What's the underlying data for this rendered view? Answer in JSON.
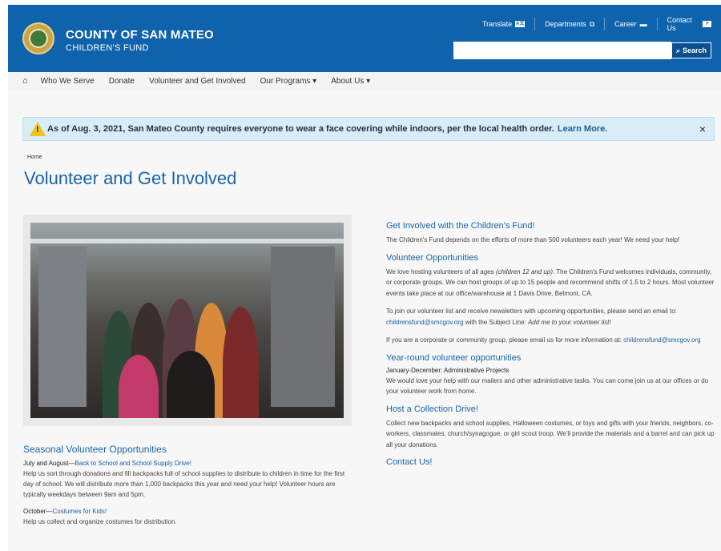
{
  "header": {
    "title": "COUNTY OF SAN MATEO",
    "subtitle": "CHILDREN'S FUND",
    "links": [
      "Translate",
      "Departments",
      "Career",
      "Contact Us"
    ],
    "search_placeholder": "",
    "search_button": "Search",
    "brand_color": "#0f62ac"
  },
  "nav": {
    "items": [
      "Who We Serve",
      "Donate",
      "Volunteer and Get Involved",
      "Our Programs ▾",
      "About Us ▾"
    ]
  },
  "alert": {
    "text": "As of Aug. 3, 2021, San Mateo County requires everyone to wear a face covering while indoors, per the local health order.",
    "link": "Learn More.",
    "close": "×"
  },
  "breadcrumb": "Home",
  "page_title": "Volunteer and Get Involved",
  "left": {
    "heading": "Seasonal Volunteer Opportunities",
    "items": [
      {
        "when": "July and August—",
        "link": "Back to School and School Supply Drive!",
        "text": "Help us sort through donations and fill backpacks full of school supplies to distribute to children in time for the first day of school. We will distribute more than 1,000 backpacks this year and need your help! Volunteer hours are typically weekdays between 9am and 5pm."
      },
      {
        "when": "October—",
        "link": "Costumes for Kids!",
        "text": "Help us collect and organize costumes for distribution."
      }
    ]
  },
  "right": {
    "get_involved_h": "Get Involved with the Children's Fund!",
    "get_involved_p": "The Children's Fund depends on the efforts of more than 500 volunteers each year! We need your help!",
    "vol_opps_h": "Volunteer Opportunities",
    "vol_opps_p1a": "We love hosting volunteers of all ages ",
    "vol_opps_p1b": "(children 12 and up)",
    "vol_opps_p1c": ". The Children's Fund welcomes individuals, community, or corporate groups. We can host groups of up to 15 people and recommend shifts of 1.5 to 2 hours. Most volunteer events take place at our office/warehouse at 1 Davis Drive, Belmont, CA.",
    "vol_opps_p2a": "To join our volunteer list and receive newsletters with upcoming opportunities, please send an email to: ",
    "vol_opps_p2link": "childrensfund@smcgov.org",
    "vol_opps_p2b": "  with the Subject Line: ",
    "vol_opps_p2c": "Add me to your volunteer list!",
    "vol_opps_p3a": "If you are a corporate or community group, please email us for more information at: ",
    "vol_opps_p3link": "childrensfund@smcgov.org",
    "yr_h": "Year-round volunteer opportunities",
    "yr_sub": "January-December:  Administrative Projects",
    "yr_p": "We would love your help with our mailers and other administrative tasks. You can come join us at our offices or do your volunteer work from home.",
    "collect_h": "Host a Collection Drive!",
    "collect_p": "Collect new backpacks and school supplies, Halloween costumes, or toys and gifts with your friends, neighbors, co-workers, classmates, church/synagogue, or girl scout troop. We'll provide the materials and a barrel and can pick up all your donations.",
    "contact_h": "Contact Us!"
  }
}
